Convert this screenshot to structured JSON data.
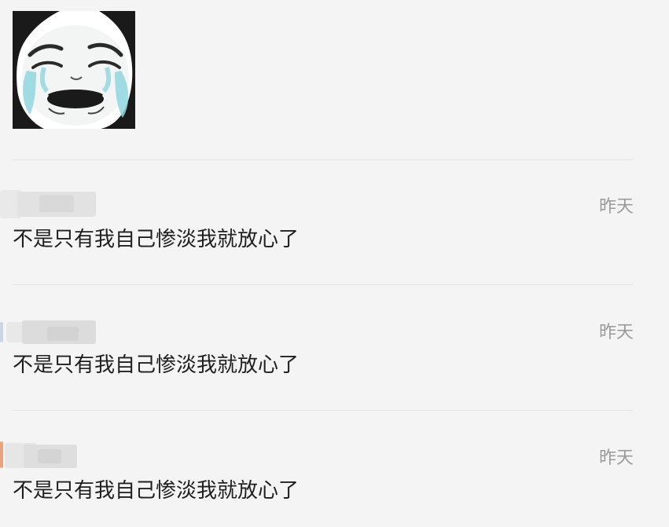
{
  "sticker": {
    "icon": "crying-panda-meme-icon"
  },
  "comments": [
    {
      "username_hidden": true,
      "timestamp": "昨天",
      "text": "不是只有我自己惨淡我就放心了"
    },
    {
      "username_hidden": true,
      "timestamp": "昨天",
      "text": "不是只有我自己惨淡我就放心了"
    },
    {
      "username_hidden": true,
      "timestamp": "昨天",
      "text": "不是只有我自己惨淡我就放心了"
    }
  ],
  "colors": {
    "background": "#f4f4f4",
    "divider": "#e4e4e4",
    "timestamp": "#9a9a9a",
    "text": "#1f1f1f"
  }
}
